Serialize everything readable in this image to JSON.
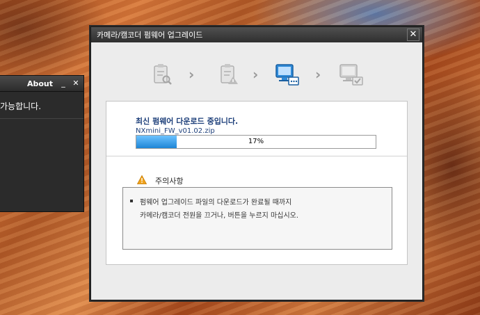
{
  "about_window": {
    "title": "About",
    "minimize_icon": "minimize-icon",
    "close_icon": "close-icon",
    "minimize_glyph": "_",
    "close_glyph": "✕",
    "body_text": "가능합니다."
  },
  "dialog": {
    "title": "카메라/캠코더 펌웨어 업그레이드",
    "close_glyph": "✕",
    "steps": [
      {
        "icon": "checklist-search-icon",
        "state": "done"
      },
      {
        "icon": "checklist-warning-icon",
        "state": "done"
      },
      {
        "icon": "computer-download-icon",
        "state": "active"
      },
      {
        "icon": "computer-check-icon",
        "state": "pending"
      }
    ],
    "arrow_glyph": "›",
    "status_message": "최신 펌웨어 다운로드 중입니다.",
    "file_name": "NXmini_FW_v01.02.zip",
    "progress_text": "17%",
    "progress_fraction": 0.17,
    "warning_title": "주의사항",
    "warning_icon": "warning-icon",
    "notice_line1": "펌웨어 업그레이드 파일의 다운로드가 완료될 때까지",
    "notice_line2": "카메라/캠코더 전원을 끄거나, 버튼을 누르지 마십시오.",
    "accent_color": "#1e86d6"
  }
}
